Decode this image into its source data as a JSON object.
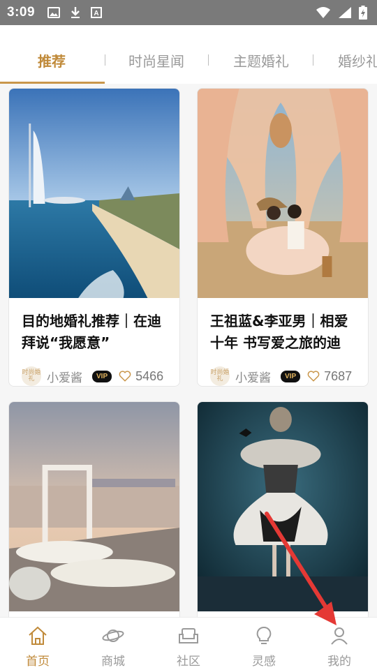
{
  "status_bar": {
    "time": "3:09",
    "left_icons": [
      "image-icon",
      "download-icon",
      "font-icon"
    ],
    "right_icons": [
      "wifi-icon",
      "signal-icon",
      "battery-icon"
    ]
  },
  "tabs": [
    {
      "label": "推荐",
      "active": true
    },
    {
      "label": "时尚星闻",
      "active": false
    },
    {
      "label": "主题婚礼",
      "active": false
    },
    {
      "label": "婚纱礼",
      "active": false
    }
  ],
  "cards": [
    {
      "title": "目的地婚礼推荐｜在迪拜说“我愿意”",
      "author": "小爱酱",
      "badge": "VIP",
      "likes": "5466",
      "image": "burj-al-arab-beach-photo",
      "avatar_text": "时尚婚礼"
    },
    {
      "title": "王祖蓝&李亚男｜相爱十年 书写爱之旅的迪",
      "author": "小爱酱",
      "badge": "VIP",
      "likes": "7687",
      "image": "desert-tent-couple-photo",
      "avatar_text": "时尚婚礼"
    },
    {
      "title": "",
      "author": "",
      "badge": "",
      "likes": "",
      "image": "waterfront-floral-arch-photo"
    },
    {
      "title": "",
      "author": "",
      "badge": "",
      "likes": "",
      "image": "feather-gown-model-photo"
    }
  ],
  "bottom_nav": [
    {
      "label": "首页",
      "icon": "home-icon",
      "active": true
    },
    {
      "label": "商城",
      "icon": "planet-icon",
      "active": false
    },
    {
      "label": "社区",
      "icon": "sofa-icon",
      "active": false
    },
    {
      "label": "灵感",
      "icon": "lightbulb-icon",
      "active": false
    },
    {
      "label": "我的",
      "icon": "profile-icon",
      "active": false
    }
  ],
  "colors": {
    "accent": "#c08a3a",
    "status_bar": "#7a7a7a",
    "annotation_arrow": "#e53935"
  }
}
